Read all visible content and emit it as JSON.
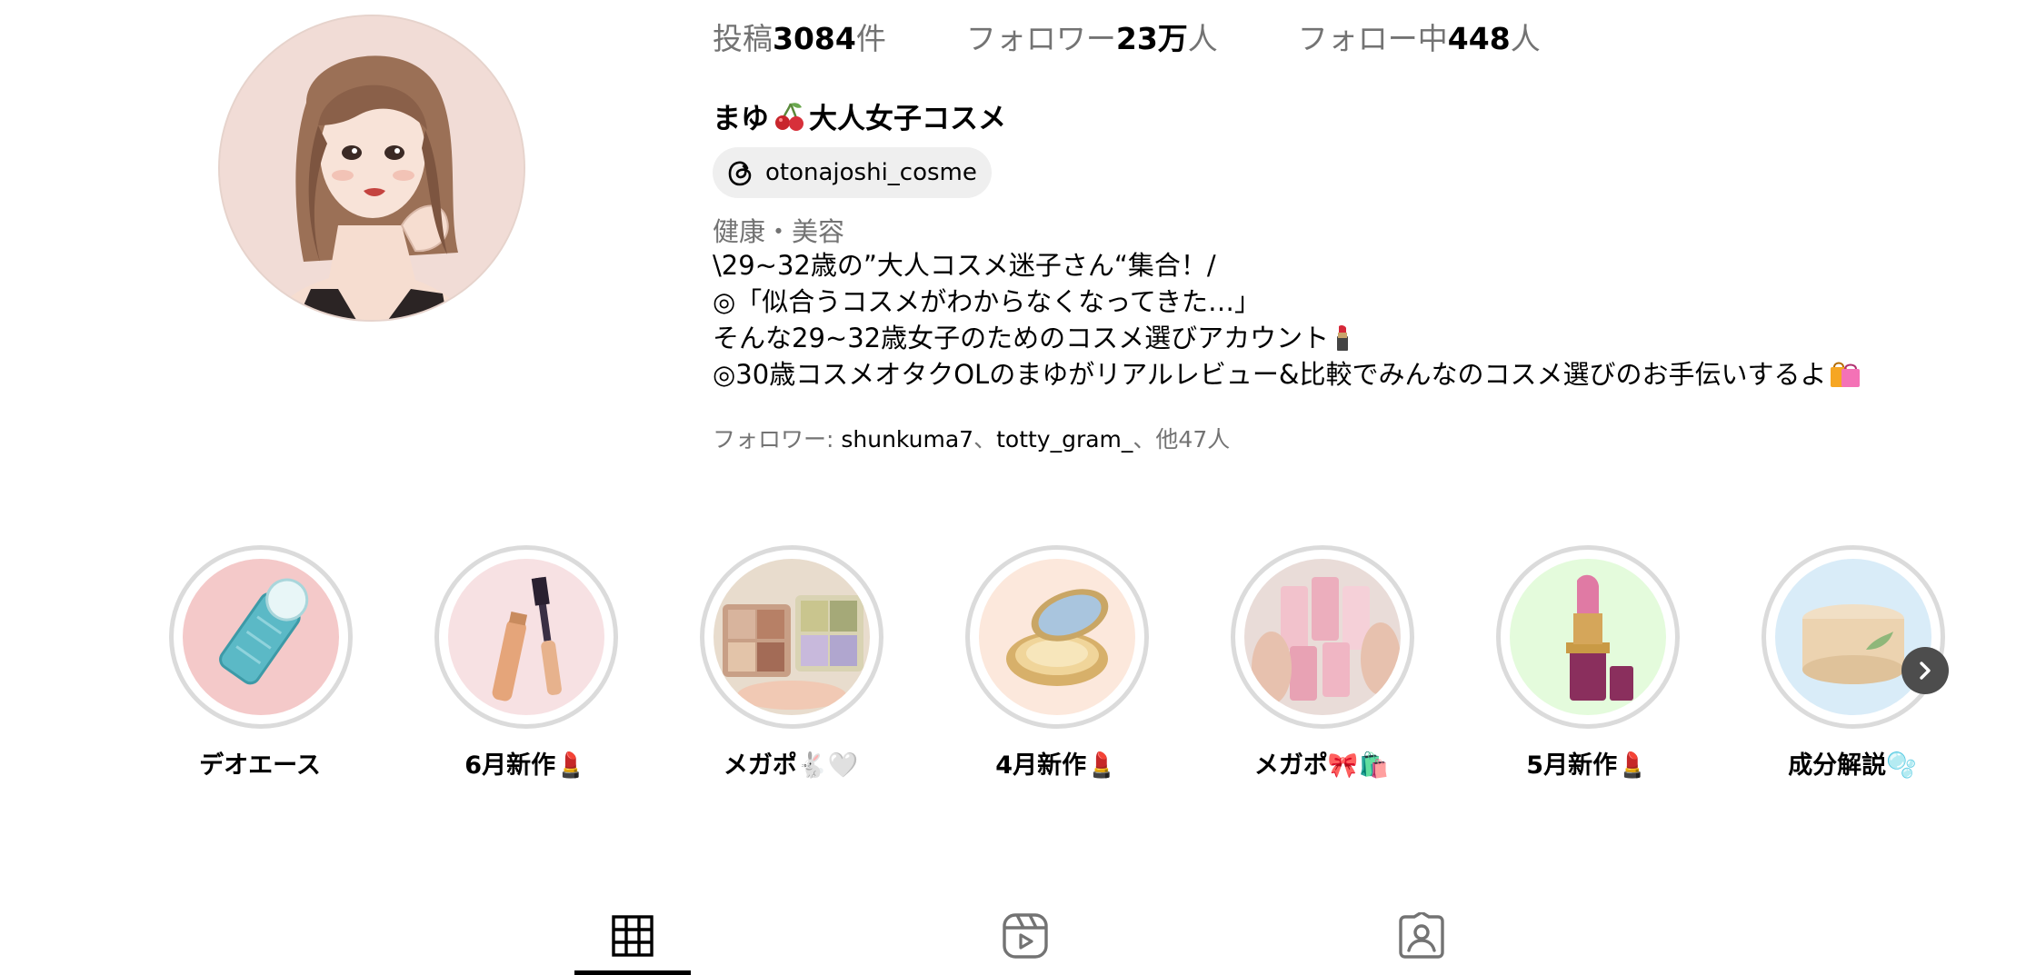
{
  "profile": {
    "posts_label": "投稿",
    "posts_count": "3084",
    "posts_unit": "件",
    "followers_label": "フォロワー",
    "followers_count": "23万",
    "followers_unit": "人",
    "following_label": "フォロー中",
    "following_count": "448",
    "following_unit": "人",
    "display_name_part1": "まゆ",
    "display_name_part2": "大人女子コスメ",
    "threads_handle": "otonajoshi_cosme",
    "category": "健康・美容",
    "bio_lines": [
      "\\29~32歳の”大人コスメ迷子さん“集合！/",
      "◎「似合うコスメがわからなくなってきた…」",
      "そんな29~32歳女子のためのコスメ選びアカウント",
      "◎30歳コスメオタクOLのまゆがリアルレビュー&比較でみんなのコスメ選びのお手伝いするよ"
    ],
    "followed_by_prefix": "フォロワー: ",
    "followed_by_user1": "shunkuma7",
    "followed_by_sep1": "、",
    "followed_by_user2": "totty_gram_",
    "followed_by_suffix": "、他47人"
  },
  "highlights": [
    {
      "label": "デオエース",
      "icon": "deodorant-roller-icon",
      "bg": "#f4c9c9"
    },
    {
      "label": "6月新作💄",
      "icon": "mascara-icon",
      "bg": "#f7e1e3"
    },
    {
      "label": "メガポ🐇🤍",
      "icon": "eyeshadow-palette-photo",
      "bg": "#e8dccd"
    },
    {
      "label": "4月新作💄",
      "icon": "compact-powder-icon",
      "bg": "#fce8dc"
    },
    {
      "label": "メガポ🎀🛍️",
      "icon": "lip-tint-photo",
      "bg": "#e9dcd8"
    },
    {
      "label": "5月新作💄",
      "icon": "lipstick-icon",
      "bg": "#e4fbdc"
    },
    {
      "label": "成分解説🫧",
      "icon": "cream-jar-icon",
      "bg": "#d9ecf8"
    }
  ],
  "tabs": [
    {
      "name": "posts-grid",
      "icon": "grid-icon"
    },
    {
      "name": "reels",
      "icon": "reels-icon"
    },
    {
      "name": "tagged",
      "icon": "tagged-user-icon"
    }
  ]
}
